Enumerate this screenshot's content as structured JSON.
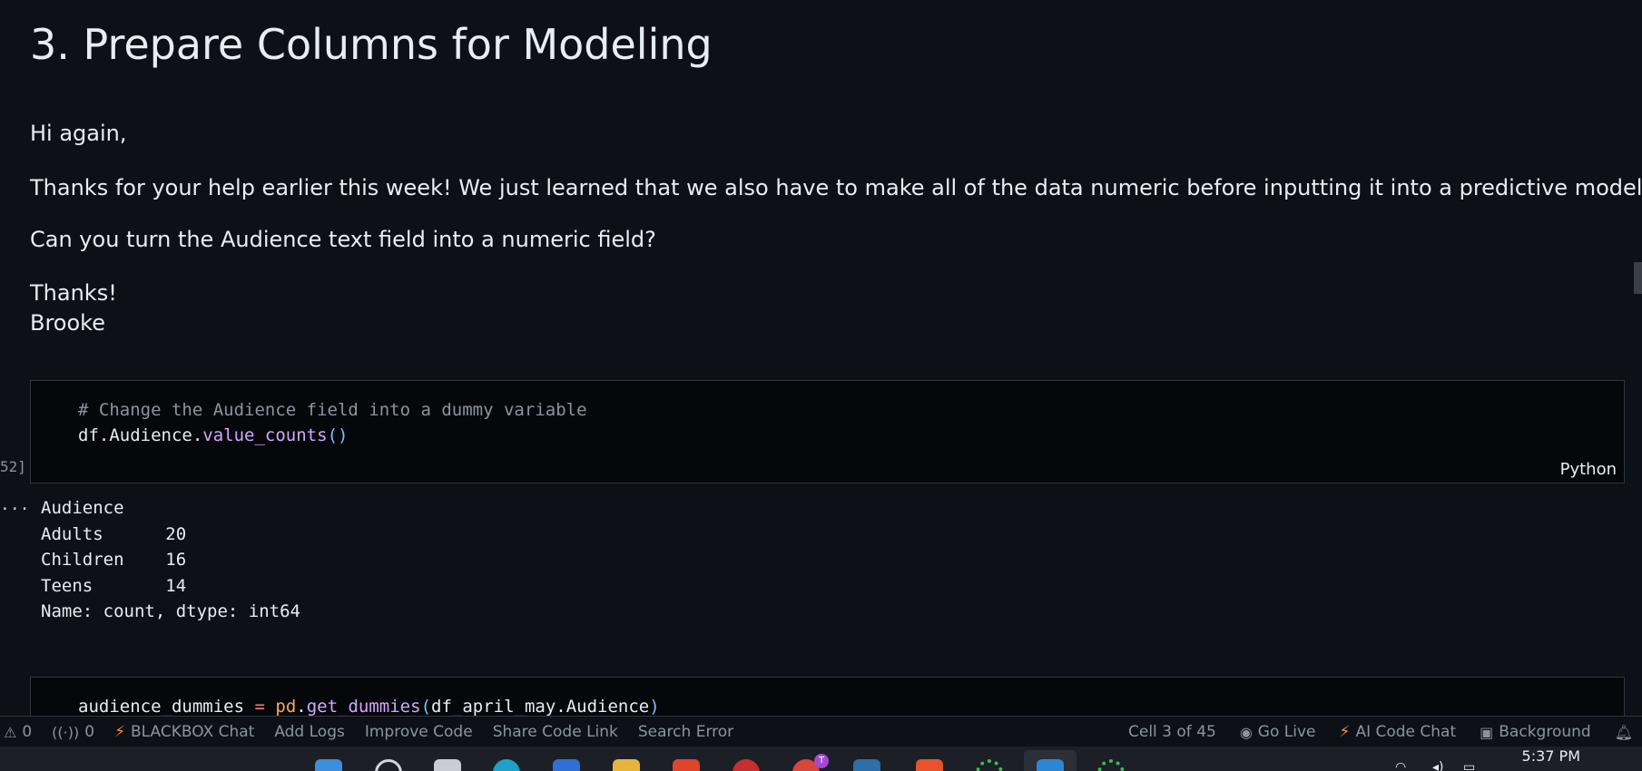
{
  "notebook": {
    "heading": "3. Prepare Columns for Modeling",
    "markdown_lines": [
      "Hi again,",
      "Thanks for your help earlier this week! We just learned that we also have to make all of the data numeric before inputting it into a predictive model.",
      "Can you turn the Audience text field into a numeric field?",
      "Thanks!",
      "Brooke"
    ],
    "cell1": {
      "comment": "# Change the Audience field into a dummy variable",
      "code_obj": "df.Audience.",
      "code_fn": "value_counts",
      "code_paren": "()",
      "execution_count": "52]",
      "language": "Python",
      "output_indicator": "...",
      "output_lines": [
        "Audience",
        "Adults      20",
        "Children    16",
        "Teens       14",
        "Name: count, dtype: int64"
      ]
    },
    "cell2": {
      "var": "audience_dummies",
      "eq": "=",
      "module": "pd",
      "dot": ".",
      "fn": "get_dummies",
      "paren_open": "(",
      "arg": "df_april_may.Audience",
      "paren_close": ")"
    }
  },
  "statusbar": {
    "errors": "0",
    "ports": "0",
    "left_items": [
      "BLACKBOX Chat",
      "Add Logs",
      "Improve Code",
      "Share Code Link",
      "Search Error"
    ],
    "cell_position": "Cell 3 of 45",
    "go_live": "Go Live",
    "ai_code_chat": "AI Code Chat",
    "background": "Background"
  },
  "taskbar": {
    "clock": "5:37 PM",
    "badge": "T"
  },
  "colors": {
    "background": "#0d1117",
    "cell_background": "#05070a",
    "comment": "#8b949e",
    "function": "#d2a8ff",
    "module": "#ffa657",
    "accent_bolt": "#f0883e"
  }
}
